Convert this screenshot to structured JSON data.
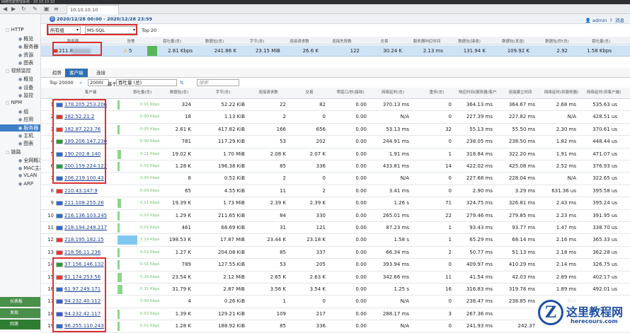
{
  "window": {
    "title": "网络性能管理系统 - 10.10.10.10",
    "tab": "10.10.10.10"
  },
  "date_range": "2020/12/28 00:00 - 2020/12/28 23:59",
  "user": "admin",
  "user_menu": "消息",
  "help": "?",
  "filters": {
    "zone": "所有组",
    "app": "MS-SQL",
    "top": "Top 20"
  },
  "sidebar": [
    {
      "label": "HTTP",
      "level": 0
    },
    {
      "label": "概览",
      "level": 1
    },
    {
      "label": "服务器",
      "level": 1
    },
    {
      "label": "资源",
      "level": 1
    },
    {
      "label": "图表",
      "level": 1
    },
    {
      "label": "视频监控",
      "level": 0
    },
    {
      "label": "概览",
      "level": 1
    },
    {
      "label": "设备",
      "level": 1
    },
    {
      "label": "监控",
      "level": 1
    },
    {
      "label": "NPM",
      "level": 0
    },
    {
      "label": "组",
      "level": 1
    },
    {
      "label": "应用",
      "level": 1
    },
    {
      "label": "服务器",
      "level": 1,
      "selected": true
    },
    {
      "label": "主机",
      "level": 1
    },
    {
      "label": "图表",
      "level": 1
    },
    {
      "label": "链路",
      "level": 0
    },
    {
      "label": "全网概况",
      "level": 1
    },
    {
      "label": "MAC主机",
      "level": 1
    },
    {
      "label": "VLAN",
      "level": 1
    },
    {
      "label": "ARP",
      "level": 1
    }
  ],
  "sidebar_footer": [
    "仪表板",
    "发现",
    "回滚"
  ],
  "server_header": [
    "服务器",
    "告警",
    "吞吐量(总)",
    "数据包(总)",
    "字节(总)",
    "连接请求数",
    "连接失败数",
    "交易",
    "服务器响应时间",
    "数据包(接收)",
    "数据包(发送)",
    "数据包/秒(总)",
    "吞吐量(总)"
  ],
  "server_row": {
    "ip": "211.8",
    "alarm": "5",
    "kbps": "2.81 Kbps",
    "packets": "241.86 K",
    "bytes": "23.15 MiB",
    "conn": "26.6 K",
    "fail": "122",
    "trans": "30.24 K",
    "resp": "2.13 ms",
    "rx": "131.94 K",
    "tx": "109.92 K",
    "pps": "2.92",
    "tput": "1.58 Kbps"
  },
  "subtabs": [
    "趋势",
    "客户端",
    "连接"
  ],
  "toolbar": {
    "top": "Top 20000",
    "count": "2000(",
    "sort_label": "基于",
    "sort_value": "吞吐量 (总)",
    "search_placeholder": "搜索"
  },
  "client_header": [
    "客户端",
    "吞吐量(总)",
    "数据包(总)",
    "字节(总)",
    "连接请求数",
    "交易",
    "零窗口/秒(接收)",
    "网络延时(总)",
    "重传(总)",
    "响应时间(服务器/客户端)",
    "连接建立时间",
    "网络延时(到服务器)",
    "网络延时(到客户端)"
  ],
  "rows": [
    {
      "ip": "178.205.253.206",
      "kbps": "0.01 Kbps",
      "p": "324",
      "b": "52.22 KiB",
      "c": "22",
      "t": "82",
      "z": "0.00",
      "nl": "370.13 ms",
      "r": "0",
      "rt": "364.13 ms",
      "ct": "364.67 ms",
      "ns": "2.68 ms",
      "nc": "535.63 us",
      "bar": 0.02
    },
    {
      "ip": "182.52.21.2",
      "kbps": "0.00 Kbps",
      "p": "18",
      "b": "1.13 KiB",
      "c": "2",
      "t": "0",
      "z": "0.00",
      "nl": "N/A",
      "r": "0",
      "rt": "227.39 ms",
      "ct": "227.82 ms",
      "ns": "N/A",
      "nc": "428.51 us",
      "bar": 0.0
    },
    {
      "ip": "182.87.223.76",
      "kbps": "0.05 Kbps",
      "p": "2.61 K",
      "b": "417.82 KiB",
      "c": "166",
      "t": "656",
      "z": "0.00",
      "nl": "53.13 ms",
      "r": "32",
      "rt": "55.13 ms",
      "ct": "55.50 ms",
      "ns": "2.30 ms",
      "nc": "370.61 us",
      "bar": 0.05
    },
    {
      "ip": "189.206.147.230",
      "kbps": "0.00 Kbps",
      "p": "781",
      "b": "117.29 KiB",
      "c": "53",
      "t": "202",
      "z": "0.00",
      "nl": "244.91 ms",
      "r": "0",
      "rt": "238.05 ms",
      "ct": "238.50 ms",
      "ns": "1.82 ms",
      "nc": "448.44 us",
      "bar": 0.0
    },
    {
      "ip": "190.202.8.140",
      "kbps": "0.21 Kbps",
      "p": "19.02 K",
      "b": "1.70 MiB",
      "c": "2.08 K",
      "t": "2.07 K",
      "z": "0.00",
      "nl": "1.91 ms",
      "r": "1",
      "rt": "318.84 ms",
      "ct": "322.20 ms",
      "ns": "1.91 ms",
      "nc": "471.07 us",
      "bar": 0.17
    },
    {
      "ip": "200.159.224.122",
      "kbps": "0.02 Kbps",
      "p": "1.28 K",
      "b": "196.38 KiB",
      "c": "85",
      "t": "336",
      "z": "0.00",
      "nl": "433.81 ms",
      "r": "14",
      "rt": "422.02 ms",
      "ct": "425.08 ms",
      "ns": "2.52 ms",
      "nc": "376.93 us",
      "bar": 0.02
    },
    {
      "ip": "206.219.100.43",
      "kbps": "0.00 Kbps",
      "p": "8",
      "b": "0.52 KiB",
      "c": "2",
      "t": "0",
      "z": "0.00",
      "nl": "N/A",
      "r": "0",
      "rt": "227.68 ms",
      "ct": "228.04 ms",
      "ns": "N/A",
      "nc": "322.65 us",
      "bar": 0.0
    },
    {
      "ip": "210.43.147.9",
      "kbps": "0.00 Kbps",
      "p": "65",
      "b": "4.55 KiB",
      "c": "11",
      "t": "2",
      "z": "0.00",
      "nl": "3.41 ms",
      "r": "0",
      "rt": "2.90 ms",
      "ct": "3.29 ms",
      "ns": "631.36 us",
      "nc": "395.58 us",
      "bar": 0.0
    },
    {
      "ip": "211.108.255.26",
      "kbps": "0.21 Kbps",
      "p": "19.39 K",
      "b": "1.73 MiB",
      "c": "2.39 K",
      "t": "2.39 K",
      "z": "0.00",
      "nl": "1.26 s",
      "r": "71",
      "rt": "324.75 ms",
      "ct": "326.81 ms",
      "ns": "2.43 ms",
      "nc": "395.24 us",
      "bar": 0.17
    },
    {
      "ip": "216.136.103.245",
      "kbps": "0.02 Kbps",
      "p": "1.29 K",
      "b": "211.65 KiB",
      "c": "84",
      "t": "330",
      "z": "0.00",
      "nl": "265.01 ms",
      "r": "22",
      "rt": "279.46 ms",
      "ct": "279.85 ms",
      "ns": "2.23 ms",
      "nc": "391.95 us",
      "bar": 0.02
    },
    {
      "ip": "218.194.248.217",
      "kbps": "0.01 Kbps",
      "p": "461",
      "b": "68.69 KiB",
      "c": "31",
      "t": "121",
      "z": "0.00",
      "nl": "87.23 ms",
      "r": "1",
      "rt": "93.43 ms",
      "ct": "93.77 ms",
      "ns": "1.47 ms",
      "nc": "338.70 us",
      "bar": 0.01
    },
    {
      "ip": "218.195.182.15",
      "kbps": "2.19 Kbps",
      "p": "198.53 K",
      "b": "17.87 MiB",
      "c": "23.44 K",
      "t": "23.18 K",
      "z": "0.00",
      "nl": "1.58 s",
      "r": "1",
      "rt": "65.29 ms",
      "ct": "68.14 ms",
      "ns": "2.16 ms",
      "nc": "365.33 us",
      "bar": 1.0
    },
    {
      "ip": "218.56.11.236",
      "kbps": "0.02 Kbps",
      "p": "1.27 K",
      "b": "204.08 KiB",
      "c": "85",
      "t": "337",
      "z": "0.00",
      "nl": "66.34 ms",
      "r": "2",
      "rt": "50.77 ms",
      "ct": "51.13 ms",
      "ns": "2.18 ms",
      "nc": "362.28 us",
      "bar": 0.02
    },
    {
      "ip": "37.156.146.132",
      "kbps": "0.01 Kbps",
      "p": "789",
      "b": "127.55 KiB",
      "c": "53",
      "t": "205",
      "z": "0.00",
      "nl": "393.94 ms",
      "r": "0",
      "rt": "409.97 ms",
      "ct": "410.29 ms",
      "ns": "2.14 ms",
      "nc": "326.75 us",
      "bar": 0.01
    },
    {
      "ip": "61.174.253.56",
      "kbps": "0.26 Kbps",
      "p": "23.54 K",
      "b": "2.12 MiB",
      "c": "2.65 K",
      "t": "2.63 K",
      "z": "0.00",
      "nl": "342.66 ms",
      "r": "11",
      "rt": "41.54 ms",
      "ct": "42.03 ms",
      "ns": "2.89 ms",
      "nc": "402.17 us",
      "bar": 0.2
    },
    {
      "ip": "61.97.249.171",
      "kbps": "0.31 Kbps",
      "p": "31.79 K",
      "b": "2.87 MiB",
      "c": "3.56 K",
      "t": "3.54 K",
      "z": "0.00",
      "nl": "1.25 s",
      "r": "16",
      "rt": "316.83 ms",
      "ct": "319.78 ms",
      "ns": "1.89 ms",
      "nc": "492.01 us",
      "bar": 0.24
    },
    {
      "ip": "94.232.40.112",
      "kbps": "0.00 Kbps",
      "p": "4",
      "b": "0.26 KiB",
      "c": "1",
      "t": "0",
      "z": "0.00",
      "nl": "N/A",
      "r": "0",
      "rt": "238.47 ms",
      "ct": "238.85 ms",
      "ns": "N/A",
      "nc": "",
      "bar": 0.0
    },
    {
      "ip": "94.232.42.117",
      "kbps": "0.02 Kbps",
      "p": "1.39 K",
      "b": "129.21 KiB",
      "c": "109",
      "t": "217",
      "z": "0.00",
      "nl": "288.17 ms",
      "r": "3",
      "rt": "267.36 ms",
      "ct": "",
      "ns": "",
      "nc": "",
      "bar": 0.02
    },
    {
      "ip": "96.255.110.243",
      "kbps": "0.02 Kbps",
      "p": "1.28 K",
      "b": "188.92 KiB",
      "c": "85",
      "t": "336",
      "z": "0.00",
      "nl": "N/A",
      "r": "0",
      "rt": "241.93 ms",
      "ct": "242.37",
      "ns": "",
      "nc": "",
      "bar": 0.02
    }
  ],
  "watermark": {
    "logo": "Z",
    "cn": "这里教程网",
    "url": "herecours.com"
  }
}
